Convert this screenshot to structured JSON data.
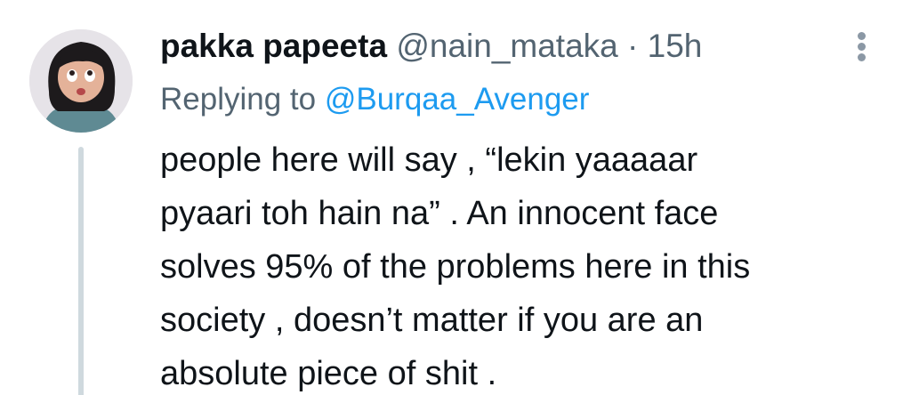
{
  "author": {
    "display_name": "pakka papeeta",
    "handle": "@nain_mataka",
    "separator": "·",
    "timestamp": "15h"
  },
  "reply_context": {
    "prefix": "Replying to",
    "mention": "@Burqaa_Avenger"
  },
  "tweet_text_lines": [
    "people here will say , “lekin yaaaaar",
    "pyaari toh hain na” . An innocent face",
    "solves 95% of the problems here in this",
    "society , doesn’t matter if you are an",
    "absolute piece of shit ."
  ],
  "icons": {
    "avatar": "cartoon-girl-avatar",
    "menu": "more-options-vertical-dots-icon"
  },
  "colors": {
    "text_primary": "#0f1419",
    "text_secondary": "#536471",
    "link": "#1d9bf0",
    "thread_line": "#cfd9de",
    "menu_dots": "#8b98a5"
  }
}
